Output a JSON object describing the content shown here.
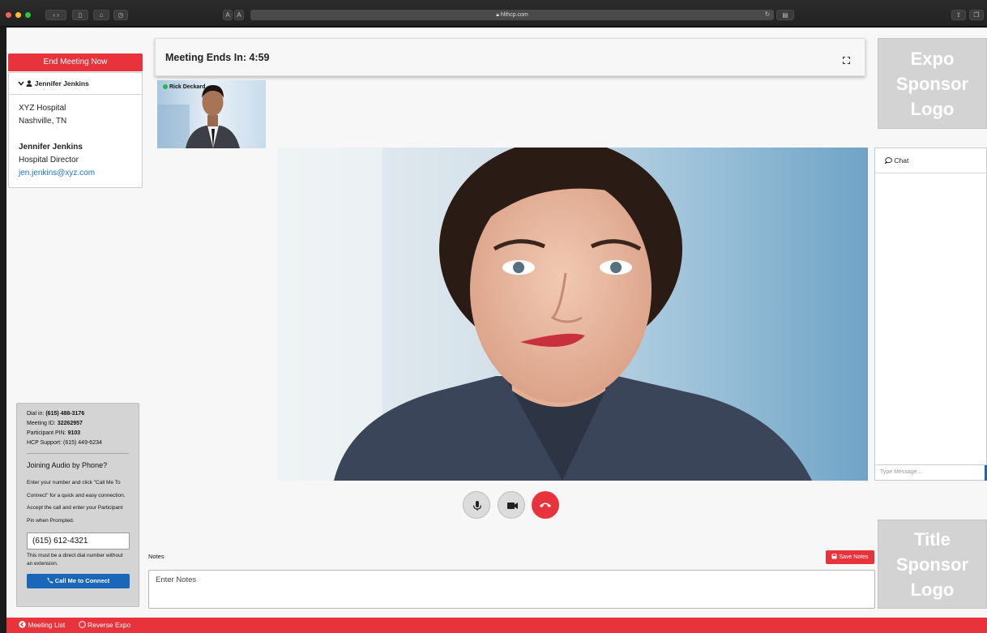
{
  "browser": {
    "url": "hlthcp.com",
    "text_size_buttons": [
      "A",
      "A"
    ]
  },
  "meeting": {
    "end_button": "End Meeting Now",
    "timer_label": "Meeting Ends In: 4:59"
  },
  "profile": {
    "name_header": "Jennifer Jenkins",
    "org": "XYZ Hospital",
    "location": "Nashville, TN",
    "contact_name": "Jennifer Jenkins",
    "contact_title": "Hospital Director",
    "contact_email": "jen.jenkins@xyz.com"
  },
  "thumbnail": {
    "participant_name": "Rick Deckard",
    "status_color": "#2cb34a"
  },
  "dial": {
    "dial_in_label": "Dial in: ",
    "dial_in_value": "(615) 488-3176",
    "meeting_id_label": "Meeting ID: ",
    "meeting_id_value": "32262957",
    "pin_label": "Participant PIN: ",
    "pin_value": "9103",
    "support": "HCP Support: (615) 449-6234",
    "joining_title": "Joining Audio by Phone?",
    "description": "Enter your number and click \"Call Me To Connect\" for a quick and easy connection. Accept the call and enter your Participant Pin when Prompted.",
    "phone_value": "(615) 612-4321",
    "phone_note": "This must be a direct dial number without an extension.",
    "call_button": "Call Me to Connect"
  },
  "controls": {
    "mic": "microphone-icon",
    "camera": "camera-icon",
    "hangup": "hangup-icon"
  },
  "notes": {
    "label": "Notes",
    "save_button": "Save Notes",
    "placeholder": "Enter Notes"
  },
  "chat": {
    "title": "Chat",
    "placeholder": "Type Message..."
  },
  "sponsors": {
    "expo": [
      "Expo",
      "Sponsor",
      "Logo"
    ],
    "title": [
      "Title",
      "Sponsor",
      "Logo"
    ]
  },
  "footer": {
    "meeting_list": "Meeting List",
    "reverse_expo": "Reverse Expo"
  },
  "colors": {
    "accent_red": "#e8333d",
    "link_blue": "#1a73c7",
    "button_blue": "#1a66b8"
  }
}
